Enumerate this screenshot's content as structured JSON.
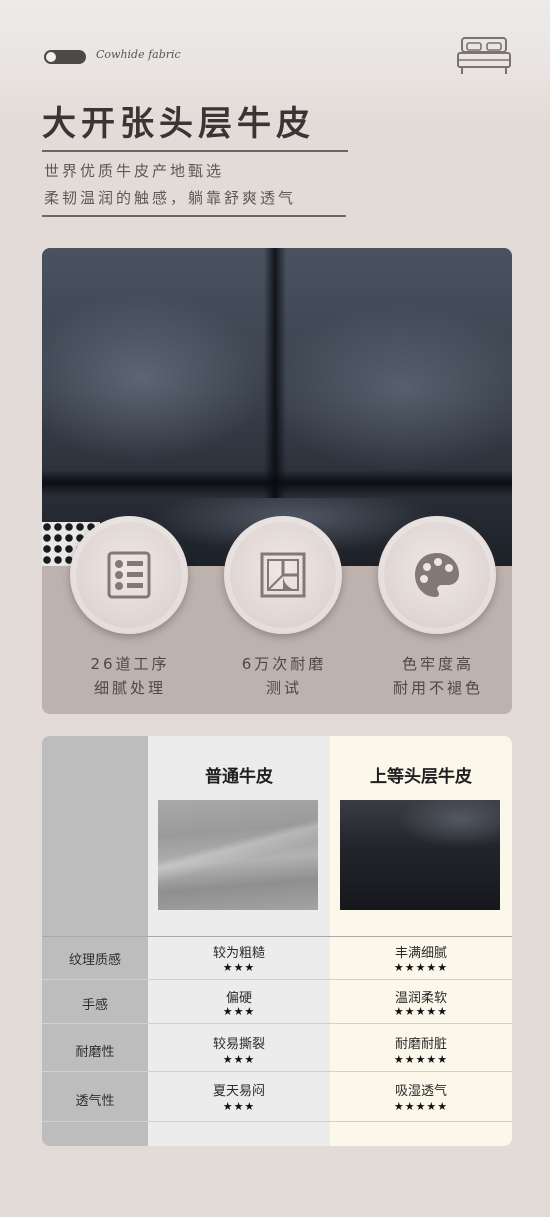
{
  "header": {
    "brand_text": "Cowhide fabric",
    "bed_icon": "bed-icon",
    "title": "大开张头层牛皮",
    "lines": [
      "世界优质牛皮产地甄选",
      "柔韧温润的触感，躺靠舒爽透气"
    ]
  },
  "features": [
    {
      "icon": "process-layers-icon",
      "line1": "26道工序",
      "line2": "细腻处理"
    },
    {
      "icon": "square-pattern-icon",
      "line1": "6万次耐磨",
      "line2": "测试"
    },
    {
      "icon": "palette-icon",
      "line1": "色牢度高",
      "line2": "耐用不褪色"
    }
  ],
  "comparison": {
    "columns": [
      "普通牛皮",
      "上等头层牛皮"
    ],
    "rows": [
      {
        "label": "纹理质感",
        "normal": "较为粗糙",
        "normal_stars": "★★★",
        "premium": "丰满细腻",
        "premium_stars": "★★★★★"
      },
      {
        "label": "手感",
        "normal": "偏硬",
        "normal_stars": "★★★",
        "premium": "温润柔软",
        "premium_stars": "★★★★★"
      },
      {
        "label": "耐磨性",
        "normal": "较易撕裂",
        "normal_stars": "★★★",
        "premium": "耐磨耐脏",
        "premium_stars": "★★★★★"
      },
      {
        "label": "透气性",
        "normal": "夏天易闷",
        "normal_stars": "★★★",
        "premium": "吸湿透气",
        "premium_stars": "★★★★★"
      }
    ]
  },
  "colors": {
    "background": "#e3dbd8",
    "title": "#3a3534",
    "premium_column": "#fbf7ea",
    "normal_column": "#ececec"
  }
}
